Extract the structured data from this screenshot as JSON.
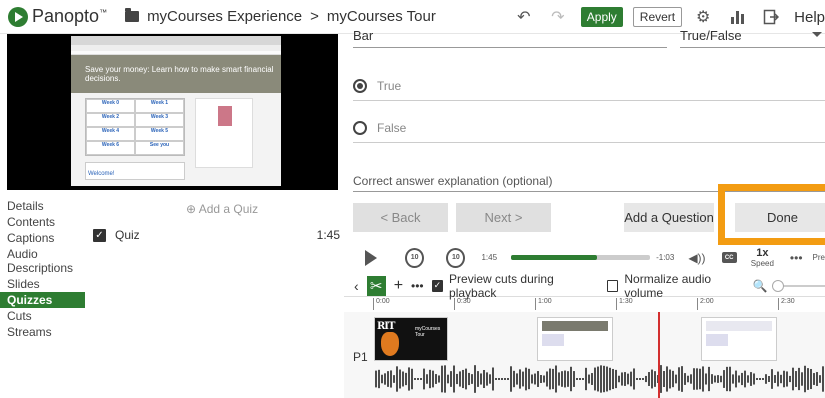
{
  "header": {
    "logo_text": "Panopto",
    "logo_tm": "™",
    "crumb_folder": "myCourses Experience",
    "crumb_sep": ">",
    "crumb_session": "myCourses Tour",
    "undo_icon": "undo-icon",
    "redo_icon": "redo-icon",
    "apply_label": "Apply",
    "revert_label": "Revert",
    "settings_icon": "gear-icon",
    "stats_icon": "bar-chart-icon",
    "exit_icon": "exit-icon",
    "help_label": "Help"
  },
  "video": {
    "banner_line1": "Save your money: Learn how to make smart financial",
    "banner_line2": "decisions.",
    "table": [
      [
        "Week 0",
        "Week 1"
      ],
      [
        "Week 2",
        "Week 3"
      ],
      [
        "Week 4",
        "Week 5"
      ],
      [
        "Week 6",
        "See you"
      ]
    ],
    "welcome": "Welcome!"
  },
  "sidebar": {
    "items": [
      {
        "label": "Details"
      },
      {
        "label": "Contents"
      },
      {
        "label": "Captions"
      },
      {
        "label": "Audio Descriptions"
      },
      {
        "label": "Slides"
      },
      {
        "label": "Quizzes",
        "active": true
      },
      {
        "label": "Cuts"
      },
      {
        "label": "Streams"
      }
    ]
  },
  "quizzes": {
    "add_label": "⊕ Add a Quiz",
    "items": [
      {
        "label": "Quiz",
        "time": "1:45"
      }
    ]
  },
  "editor": {
    "question_value": "Bar",
    "type_value": "True/False",
    "options": [
      {
        "label": "True",
        "selected": true
      },
      {
        "label": "False",
        "selected": false
      }
    ],
    "explanation_placeholder": "Correct answer explanation (optional)"
  },
  "buttons": {
    "back": "< Back",
    "next": "Next >",
    "add_question": "Add a Question",
    "done": "Done",
    "highlight_color": "#f39c12"
  },
  "player": {
    "current_time": "1:45",
    "remaining_time": "-1:03",
    "progress": 0.62,
    "skip_back": "10",
    "skip_fwd": "10",
    "speed_value": "1x",
    "speed_label": "Speed",
    "cc_label": "CC",
    "more_label": "•••",
    "pre_label": "Pre"
  },
  "timeline": {
    "preview_cuts_label": "Preview cuts during playback",
    "preview_cuts_checked": true,
    "normalize_label": "Normalize audio volume",
    "normalize_checked": false,
    "ticks": [
      "0:00",
      "0:30",
      "1:00",
      "1:30",
      "2:00",
      "2:30"
    ],
    "track_label": "P1",
    "thumb1_title": "myCourses Tour",
    "thumb1_logo": "RIT",
    "playhead_color": "#d32f2f"
  }
}
